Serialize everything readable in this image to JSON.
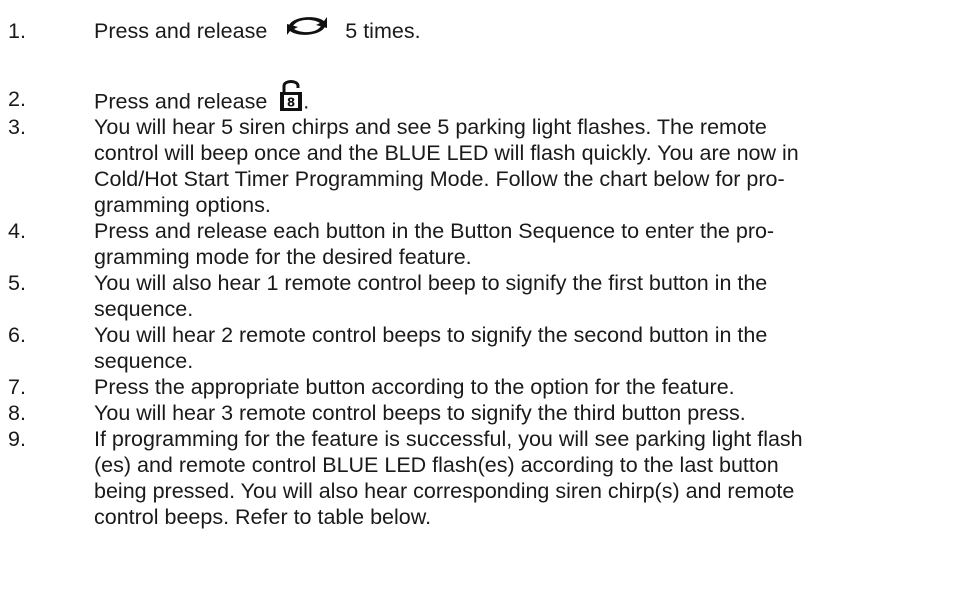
{
  "steps": [
    {
      "num": "1.",
      "pre": "Press and release",
      "icon": "remote-cycle-arrows-icon",
      "post": "5 times."
    },
    {
      "num": "2.",
      "pre": "Press and release",
      "icon": "remote-unlock-padlock-icon",
      "post": "."
    },
    {
      "num": "3.",
      "lines": [
        "You will hear 5 siren chirps and see 5 parking light flashes.  The remote",
        "control will beep once and the BLUE LED will flash quickly.  You are now in",
        "Cold/Hot Start Timer Programming Mode.  Follow the chart below for pro-",
        "gramming options."
      ]
    },
    {
      "num": "4.",
      "lines": [
        "Press and release each button in the Button Sequence to enter the pro-",
        "gramming mode for the desired feature."
      ]
    },
    {
      "num": "5.",
      "lines": [
        "You will also hear 1 remote control beep to signify the first button in the",
        "sequence."
      ]
    },
    {
      "num": "6.",
      "lines": [
        "You will hear 2 remote control beeps to signify the second button in the",
        "sequence."
      ]
    },
    {
      "num": "7.",
      "lines": [
        "Press the appropriate  button according to the option for the feature."
      ]
    },
    {
      "num": "8.",
      "lines": [
        "You will hear 3 remote control beeps to signify the third button press."
      ]
    },
    {
      "num": "9.",
      "lines": [
        "If programming for the feature is successful, you will see parking light flash",
        "(es) and remote control BLUE LED flash(es) according to the last button",
        "being pressed.  You will also hear corresponding siren chirp(s) and remote",
        "control beeps.  Refer to table below."
      ]
    }
  ]
}
